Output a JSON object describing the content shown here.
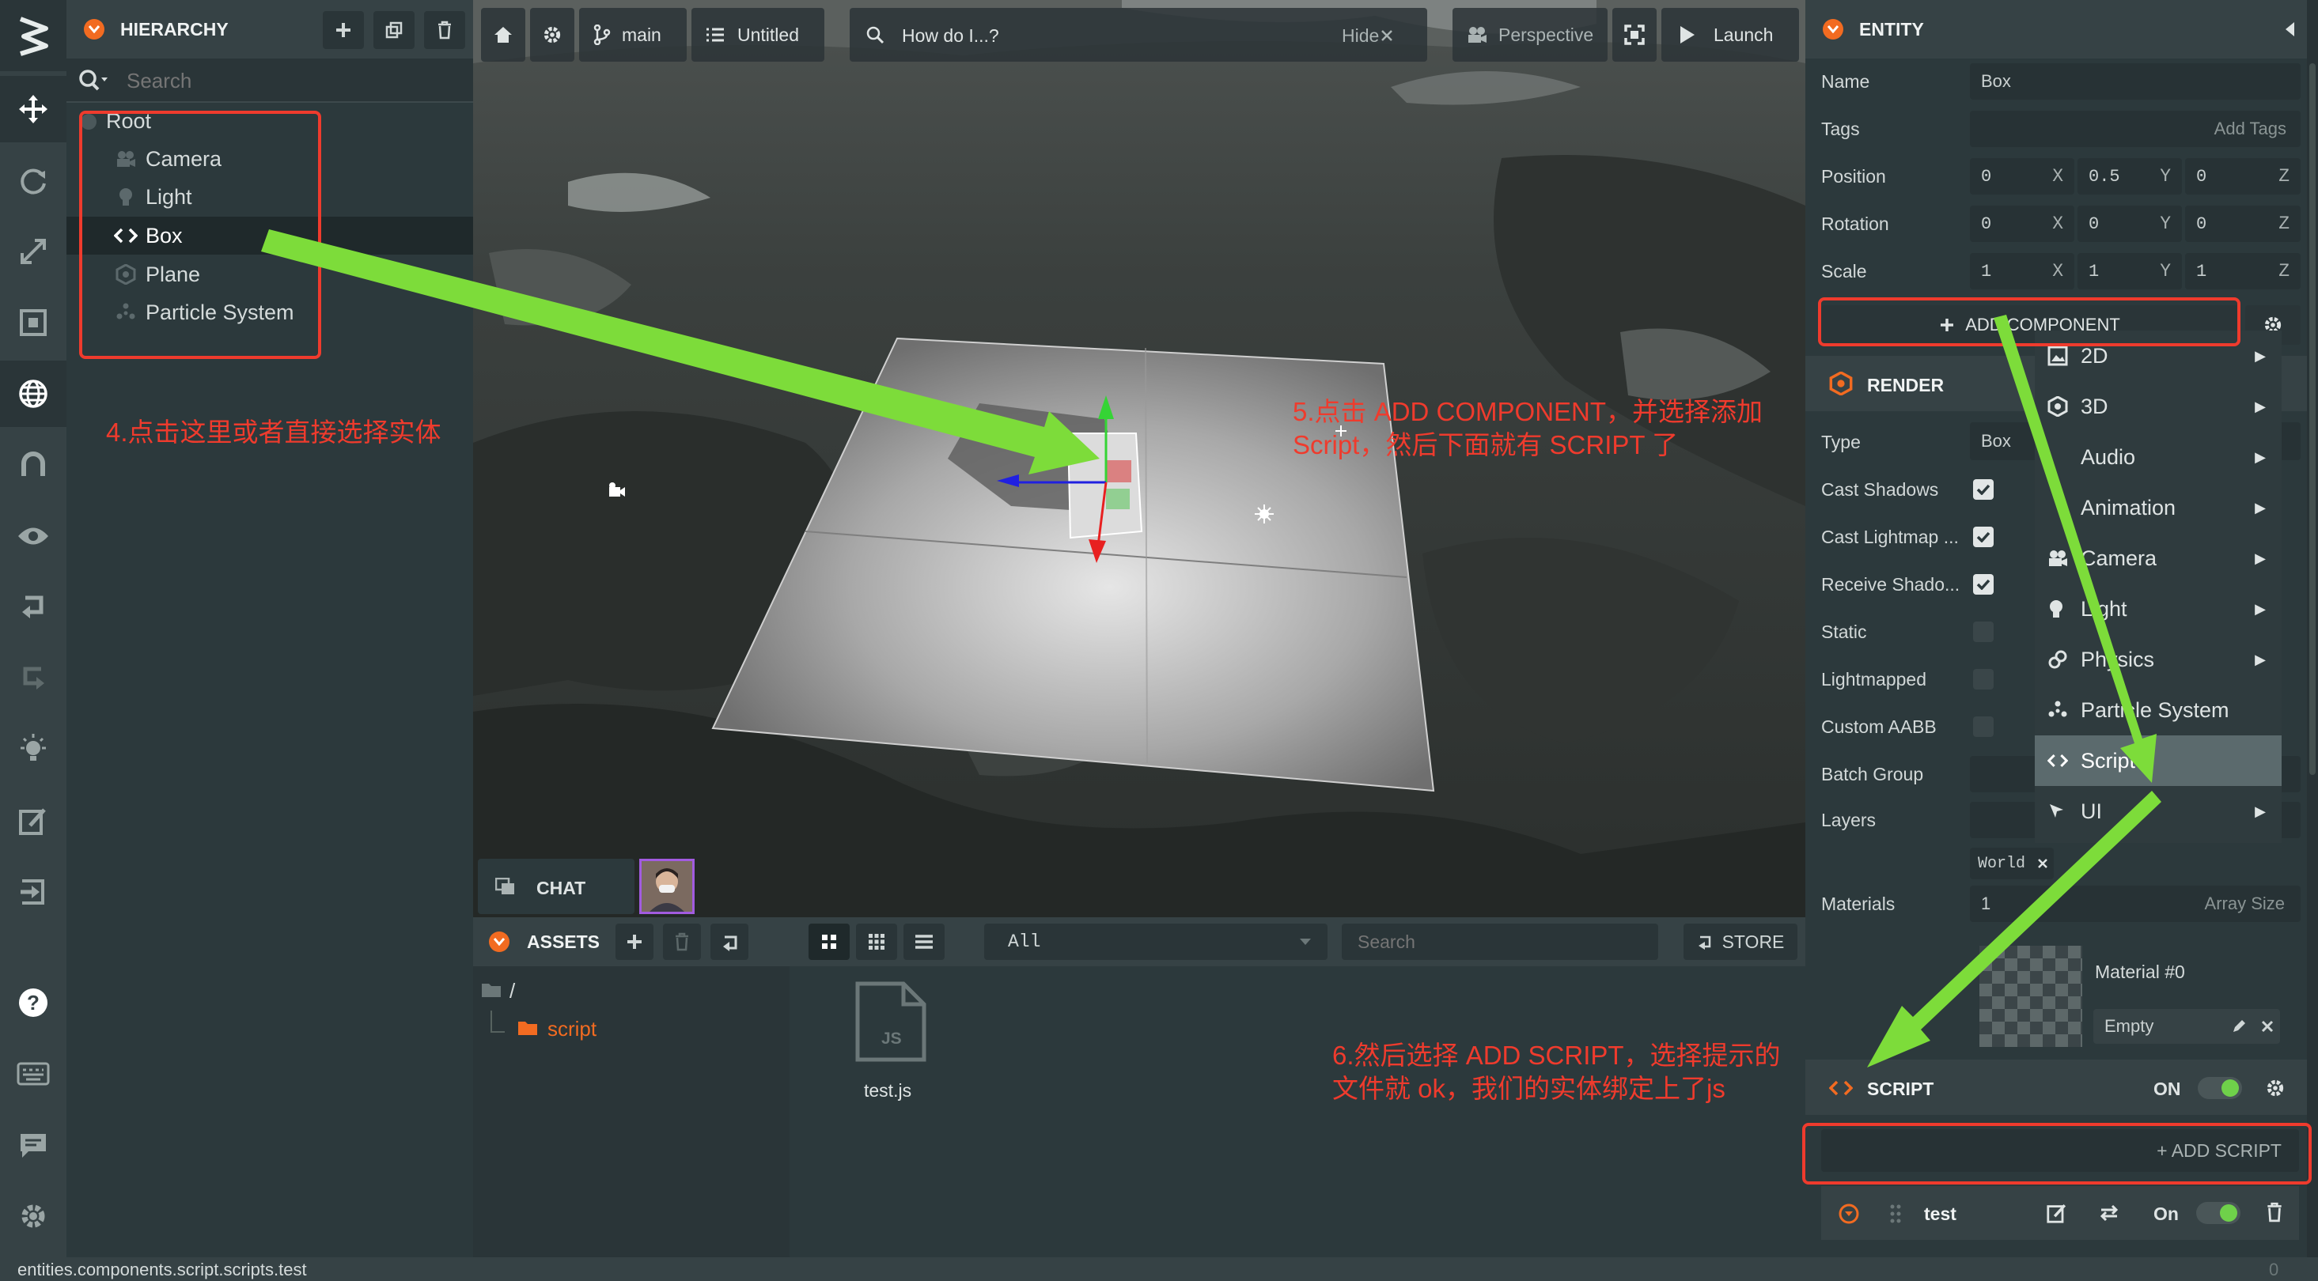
{
  "hierarchy": {
    "title": "HIERARCHY",
    "search_placeholder": "Search",
    "items": [
      "Root",
      "Camera",
      "Light",
      "Box",
      "Plane",
      "Particle System"
    ]
  },
  "toolbar": {
    "branch": "main",
    "scene": "Untitled",
    "help_text": "How do I...?",
    "hide_label": "Hide",
    "camera_label": "Perspective",
    "launch_label": "Launch"
  },
  "chat": {
    "label": "CHAT"
  },
  "assets": {
    "title": "ASSETS",
    "filter": "All",
    "search_placeholder": "Search",
    "store_label": "STORE",
    "tree_root": "/",
    "tree_folder": "script",
    "file_name": "test.js",
    "file_badge": "JS"
  },
  "entity": {
    "title": "ENTITY",
    "name_label": "Name",
    "name_value": "Box",
    "tags_label": "Tags",
    "tags_placeholder": "Add Tags",
    "position_label": "Position",
    "position": [
      "0",
      "0.5",
      "0"
    ],
    "rotation_label": "Rotation",
    "rotation": [
      "0",
      "0",
      "0"
    ],
    "scale_label": "Scale",
    "scale": [
      "1",
      "1",
      "1"
    ],
    "axes": [
      "X",
      "Y",
      "Z"
    ],
    "add_component": "ADD COMPONENT"
  },
  "render": {
    "title": "RENDER",
    "type_label": "Type",
    "type_value": "Box",
    "cast_shadows": "Cast Shadows",
    "cast_lightmap": "Cast Lightmap ...",
    "receive_shadows": "Receive Shado...",
    "static": "Static",
    "lightmapped": "Lightmapped",
    "custom_aabb": "Custom AABB",
    "batch_group": "Batch Group",
    "layers": "Layers",
    "layer_tag": "World",
    "materials_label": "Materials",
    "materials_count": "1",
    "array_size": "Array Size",
    "material_name": "Material #0",
    "material_value": "Empty"
  },
  "component_menu": {
    "items": [
      "2D",
      "3D",
      "Audio",
      "Animation",
      "Camera",
      "Light",
      "Physics",
      "Particle System",
      "Script",
      "UI"
    ]
  },
  "script": {
    "title": "SCRIPT",
    "on_label": "ON",
    "add_script": "+ ADD SCRIPT",
    "script_name": "test",
    "script_on": "On"
  },
  "status": {
    "path": "entities.components.script.scripts.test",
    "count": "0"
  },
  "annotations": {
    "step4": "4.点击这里或者直接选择实体",
    "step5_line1": "5.点击 ADD COMPONENT，并选择添加",
    "step5_line2": "Script，然后下面就有 SCRIPT 了",
    "step6_line1": "6.然后选择 ADD SCRIPT，选择提示的",
    "step6_line2": "文件就 ok，我们的实体绑定上了js"
  },
  "colors": {
    "accent_orange": "#f26b21",
    "annotation_red": "#ef3b2d",
    "arrow_green": "#7ddc3a",
    "toggle_green": "#6fd14a",
    "panel_bg": "#2c393c",
    "sidebar_bg": "#364245"
  }
}
